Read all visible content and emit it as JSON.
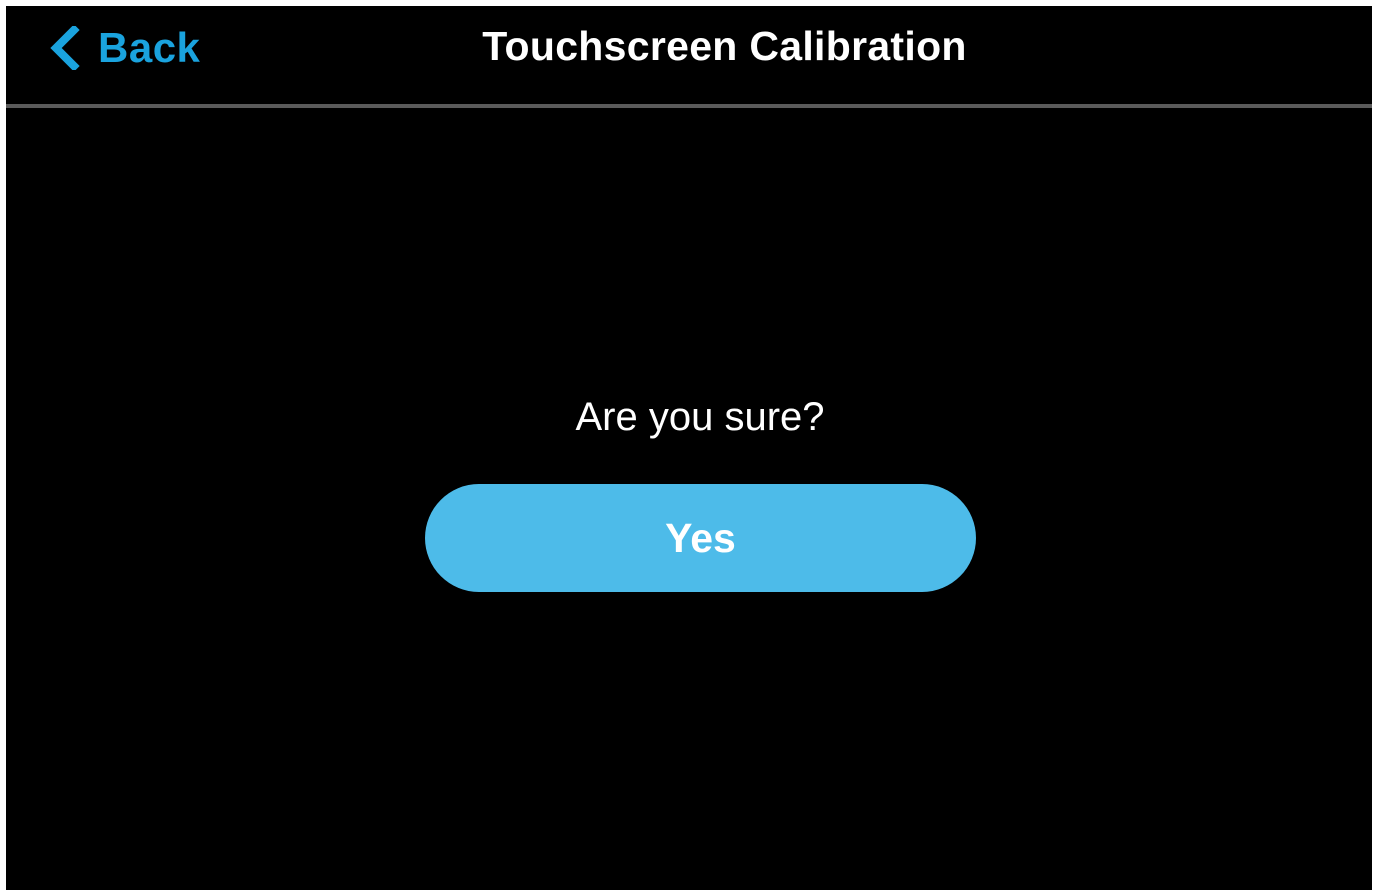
{
  "header": {
    "back_label": "Back",
    "back_icon": "chevron-left-icon",
    "title": "Touchscreen Calibration"
  },
  "dialog": {
    "prompt": "Are you sure?",
    "confirm_label": "Yes"
  },
  "colors": {
    "background": "#000000",
    "accent": "#1aa3de",
    "button": "#4dbbe9",
    "divider": "#5a5a5a",
    "text": "#ffffff"
  }
}
